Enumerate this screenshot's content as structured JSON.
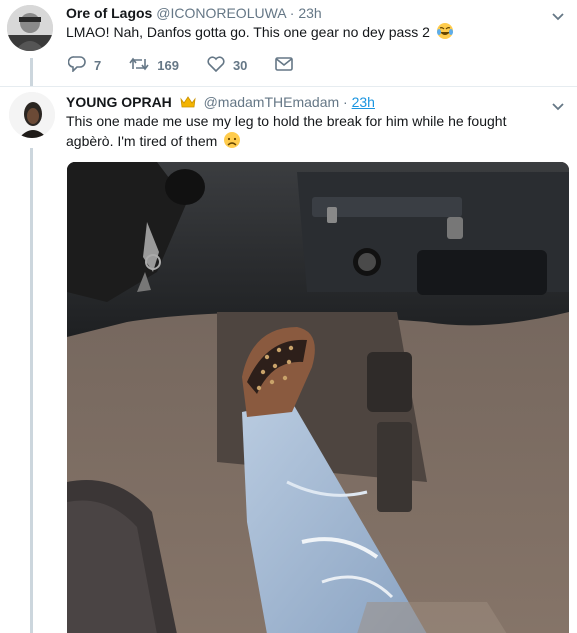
{
  "tweet1": {
    "name": "Ore of Lagos",
    "handle": "@ICONOREOLUWA",
    "dot": "·",
    "time": "23h",
    "text": "LMAO! Nah, Danfos gotta go. This one gear no dey pass 2",
    "emoji": "tears-of-joy-emoji",
    "replies": "7",
    "retweets": "169",
    "likes": "30",
    "icons": {
      "reply": "reply-icon",
      "retweet": "retweet-icon",
      "like": "heart-icon",
      "dm": "envelope-icon",
      "menu": "chevron-down-icon"
    }
  },
  "tweet2": {
    "name": "YOUNG OPRAH",
    "badge": "crown-emoji",
    "handle": "@madamTHEmadam",
    "dot": "·",
    "time": "23h",
    "text": "This one made me use my leg to hold the break for him while he fought agbèrò. I'm tired of them",
    "emoji": "disappointed-face-emoji",
    "media": "photo of a foot in studded sandal on a bus brake pedal",
    "icons": {
      "menu": "chevron-down-icon"
    }
  },
  "colors": {
    "link": "#1b95e0",
    "muted": "#657786",
    "thread_line": "#ccd6dd",
    "divider": "#e6ecf0"
  }
}
